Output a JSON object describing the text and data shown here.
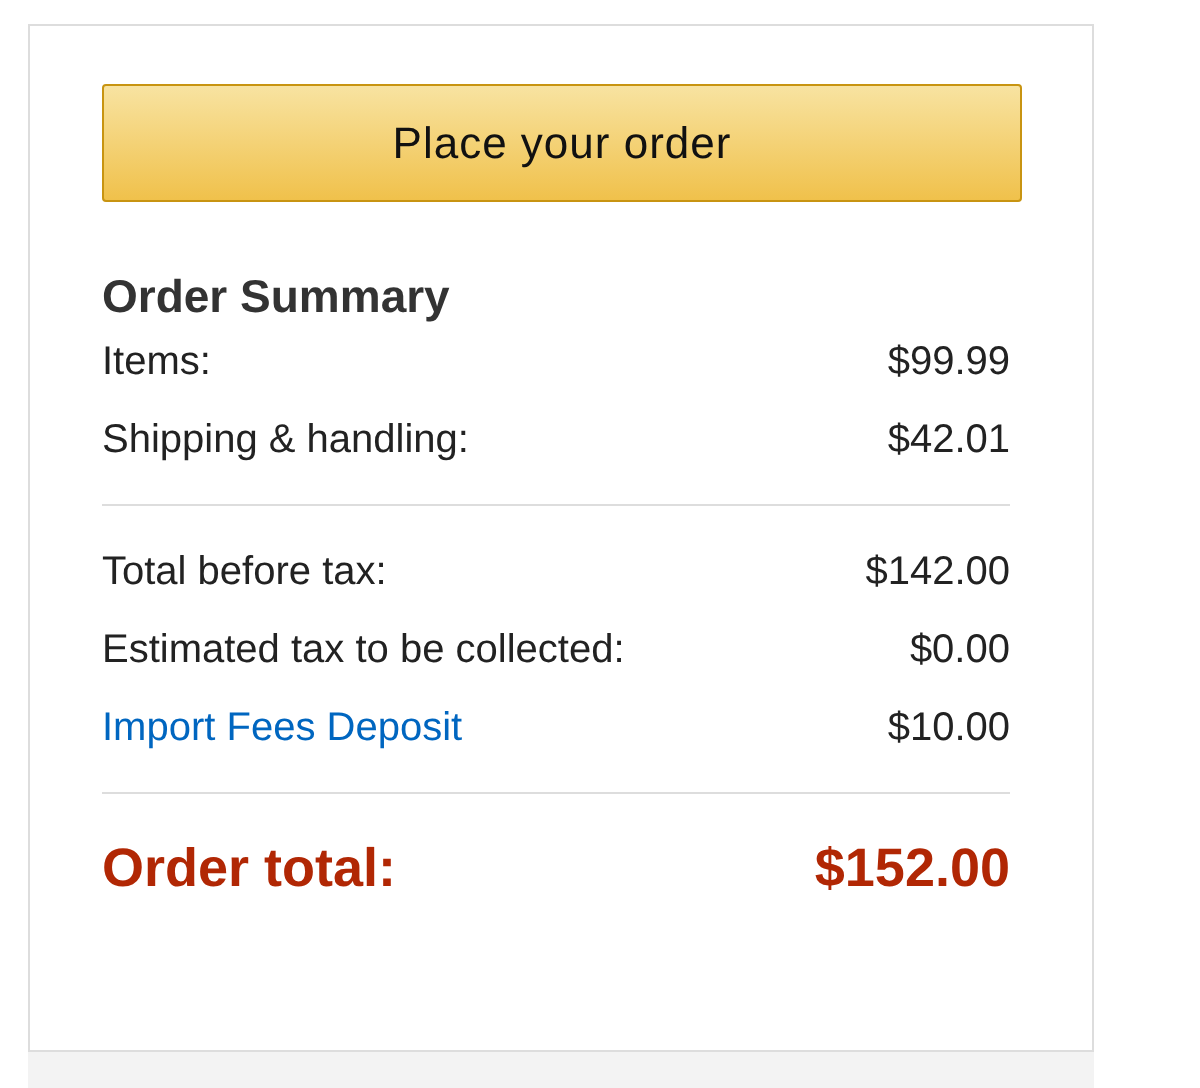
{
  "button": {
    "label": "Place your order"
  },
  "summary": {
    "title": "Order Summary",
    "groups": [
      {
        "rows": [
          {
            "kind": "text",
            "label": "Items:",
            "value": "$99.99"
          },
          {
            "kind": "text",
            "label": "Shipping & handling:",
            "value": "$42.01"
          }
        ]
      },
      {
        "rows": [
          {
            "kind": "text",
            "label": "Total before tax:",
            "value": "$142.00"
          },
          {
            "kind": "text",
            "label": "Estimated tax to be collected:",
            "value": "$0.00"
          },
          {
            "kind": "link",
            "label": "Import Fees Deposit",
            "value": "$10.00"
          }
        ]
      }
    ],
    "total": {
      "label": "Order total:",
      "value": "$152.00"
    }
  }
}
